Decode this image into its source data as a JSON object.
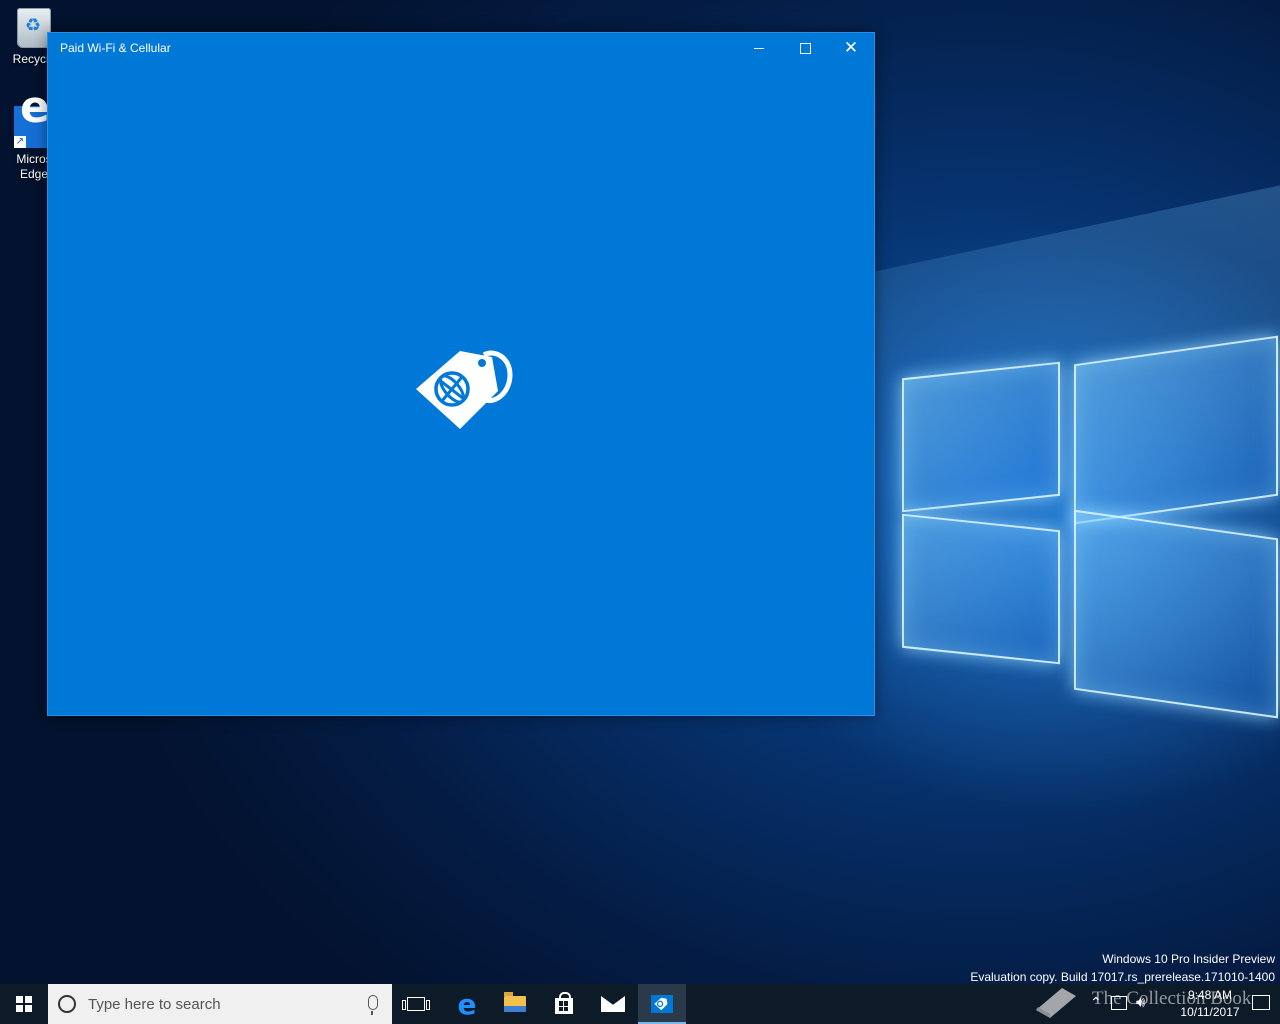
{
  "desktop": {
    "icons": [
      {
        "label": "Recycle",
        "icon": "recycle-bin-icon"
      },
      {
        "label": "Micros Edge",
        "line1": "Micros",
        "line2": "Edge",
        "icon": "edge-icon"
      }
    ]
  },
  "window": {
    "title": "Paid Wi-Fi & Cellular",
    "splash_icon": "paid-wifi-cellular-tag-globe-icon",
    "background_color": "#0078d7"
  },
  "watermark": {
    "line1": "Windows 10 Pro Insider Preview",
    "line2": "Evaluation copy. Build 17017.rs_prerelease.171010-1400",
    "brand": "The Collection Book"
  },
  "taskbar": {
    "search_placeholder": "Type here to search",
    "pinned": [
      "task-view",
      "microsoft-edge",
      "file-explorer",
      "microsoft-store",
      "mail",
      "paid-wifi-cellular"
    ],
    "clock_time": "9:48 AM",
    "clock_date": "10/11/2017"
  }
}
